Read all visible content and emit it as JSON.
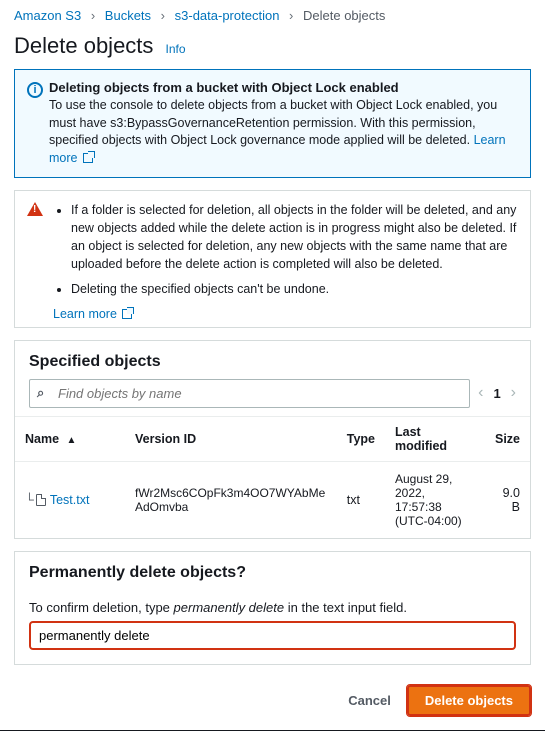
{
  "breadcrumb": {
    "root": "Amazon S3",
    "buckets": "Buckets",
    "bucket": "s3-data-protection",
    "current": "Delete objects"
  },
  "page": {
    "title": "Delete objects",
    "info": "Info"
  },
  "alert": {
    "heading": "Deleting objects from a bucket with Object Lock enabled",
    "body": "To use the console to delete objects from a bucket with Object Lock enabled, you must have s3:BypassGovernanceRetention permission. With this permission, specified objects with Object Lock governance mode applied will be deleted.",
    "learn_more": "Learn more"
  },
  "warning": {
    "item1": "If a folder is selected for deletion, all objects in the folder will be deleted, and any new objects added while the delete action is in progress might also be deleted. If an object is selected for deletion, any new objects with the same name that are uploaded before the delete action is completed will also be deleted.",
    "item2": "Deleting the specified objects can't be undone.",
    "learn_more": "Learn more"
  },
  "specified": {
    "heading": "Specified objects",
    "search_placeholder": "Find objects by name",
    "page": "1",
    "columns": {
      "name": "Name",
      "version": "Version ID",
      "type": "Type",
      "modified": "Last modified",
      "size": "Size"
    },
    "row": {
      "name": "Test.txt",
      "version": "fWr2Msc6COpFk3m4OO7WYAbMeAdOmvba",
      "type": "txt",
      "modified": "August 29, 2022, 17:57:38 (UTC-04:00)",
      "size": "9.0 B"
    }
  },
  "confirm": {
    "heading": "Permanently delete objects?",
    "prompt_pre": "To confirm deletion, type ",
    "phrase": "permanently delete",
    "prompt_post": " in the text input field.",
    "value": "permanently delete"
  },
  "footer": {
    "cancel": "Cancel",
    "delete": "Delete objects"
  }
}
